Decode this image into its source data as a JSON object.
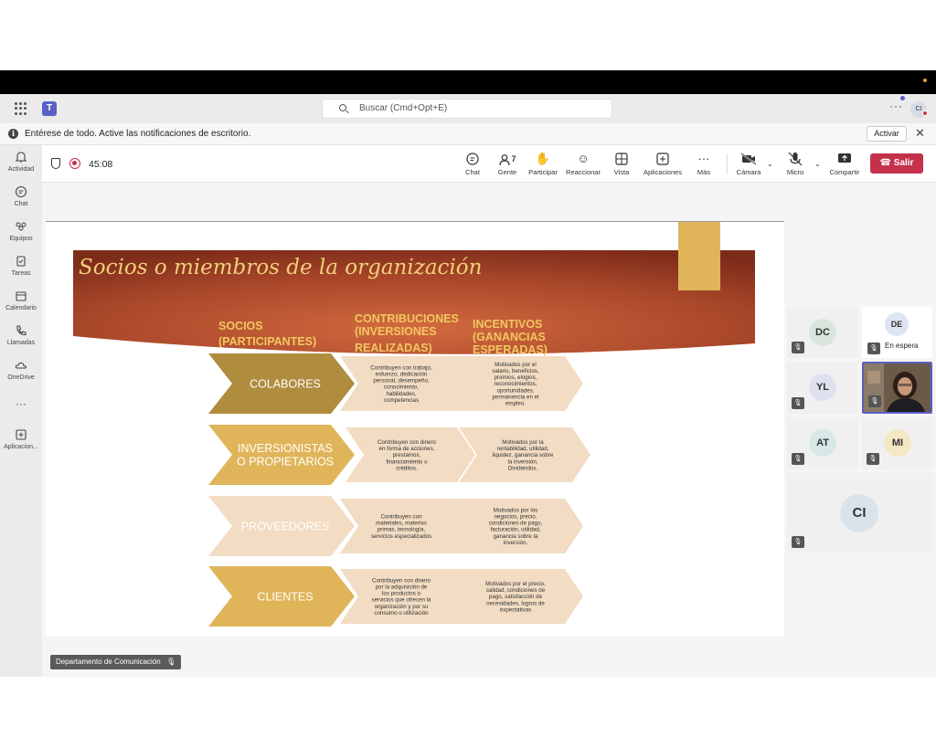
{
  "app": {
    "search_placeholder": "Buscar (Cmd+Opt+E)",
    "user_initials": "CI",
    "more": "···"
  },
  "notification": {
    "text": "Entérese de todo. Active las notificaciones de escritorio.",
    "button": "Activar"
  },
  "rail": [
    {
      "label": "Actividad",
      "icon": "bell-icon"
    },
    {
      "label": "Chat",
      "icon": "chat-icon"
    },
    {
      "label": "Equipos",
      "icon": "teams-icon"
    },
    {
      "label": "Tareas",
      "icon": "tasks-icon"
    },
    {
      "label": "Calendario",
      "icon": "calendar-icon"
    },
    {
      "label": "Llamadas",
      "icon": "phone-icon"
    },
    {
      "label": "OneDrive",
      "icon": "cloud-icon"
    },
    {
      "label": "Aplicacion...",
      "icon": "add-app-icon"
    }
  ],
  "meeting": {
    "timer": "45:08",
    "people_count": "7",
    "toolbar": {
      "chat": "Chat",
      "people": "Gente",
      "participate": "Participar",
      "react": "Reaccionar",
      "view": "Vista",
      "apps": "Aplicaciones",
      "more": "Más",
      "camera": "Cámara",
      "mic": "Micro",
      "share": "Compartir",
      "leave": "Salir"
    }
  },
  "slide": {
    "title": "Socios o miembros de la organización",
    "headers": {
      "col1": "SOCIOS (PARTICIPANTES)",
      "col2": "CONTRIBUCIONES (INVERSIONES REALIZADAS)",
      "col3": "INCENTIVOS (GANANCIAS ESPERADAS)"
    },
    "rows": [
      {
        "partner": "COLABORES",
        "contribution": "Contribuyen con trabajo, esfuerzo, dedicación personal, desempeño, conocimiento, habilidades, competencias",
        "incentive": "Motivados por el salario, beneficios, premios, elogios, reconocimientos, oportunidades, permanencia en el empleo."
      },
      {
        "partner": "INVERSIONISTAS O PROPIETARIOS",
        "contribution": "Contribuyen con dinero en forma de acciones, prestamos, financiamiento o créditos.",
        "incentive": "Motivados por la rentabilidad, utilidad, liquidez, ganancia sobre la inversión. Dividendos."
      },
      {
        "partner": "PROVEEDORES",
        "contribution": "Contribuyen con materiales, materias primas, tecnología, servicios especializados",
        "incentive": "Motivados por los negocios, precio, condiciones de pago, facturación, utilidad, ganancia sobre la inversión."
      },
      {
        "partner": "CLIENTES",
        "contribution": "Contribuyen con dinero por la adquisición de los productos o servicios que ofrecen la organización y por su consumo o utilización",
        "incentive": "Motivados por el precio, calidad, condiciones de pago, satisfacción de necesidades, logros de expectativas"
      }
    ]
  },
  "participants": [
    {
      "initials": "DC"
    },
    {
      "initials": "DE",
      "status": "En espera"
    },
    {
      "initials": "YL"
    },
    {
      "initials": "AT"
    },
    {
      "initials": "MI"
    },
    {
      "initials": "CI"
    }
  ],
  "presenter_label": "Departamento de Comunicación",
  "colors": {
    "accent": "#5b5fc7",
    "leave": "#c4314b",
    "slide_banner": "#a9472a",
    "gold": "#e0b55a",
    "tan": "#f0dcc2"
  }
}
